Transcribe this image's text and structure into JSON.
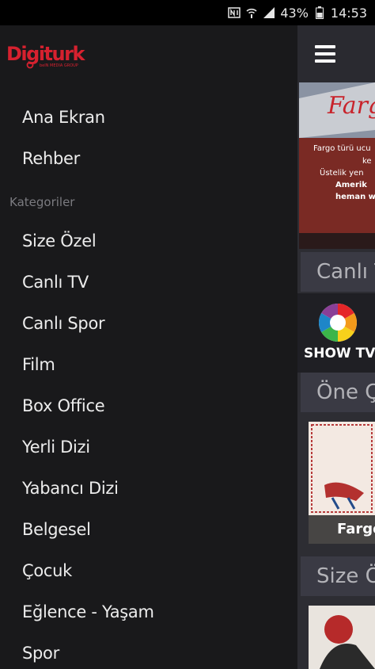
{
  "status_bar": {
    "battery": "43%",
    "time": "14:53",
    "icons": [
      "nfc-icon",
      "wifi-icon",
      "signal-icon",
      "battery-icon"
    ]
  },
  "brand": {
    "name": "Digiturk",
    "tagline": "beIN MEDIA GROUP",
    "accent": "#d6212f"
  },
  "drawer": {
    "top_items": [
      {
        "label": "Ana Ekran"
      },
      {
        "label": "Rehber"
      }
    ],
    "section_label": "Kategoriler",
    "category_items": [
      {
        "label": "Size Özel"
      },
      {
        "label": "Canlı TV"
      },
      {
        "label": "Canlı Spor"
      },
      {
        "label": "Film"
      },
      {
        "label": "Box Office"
      },
      {
        "label": "Yerli Dizi"
      },
      {
        "label": "Yabancı Dizi"
      },
      {
        "label": "Belgesel"
      },
      {
        "label": "Çocuk"
      },
      {
        "label": "Eğlence - Yaşam"
      },
      {
        "label": "Spor"
      }
    ]
  },
  "content": {
    "banner": {
      "title": "Fargo",
      "lines": [
        "Fargo türü ucu",
        "ke",
        "Üstelik yen",
        "Amerik",
        "heman w"
      ]
    },
    "section_live": "Canlı T",
    "channel_name": "SHOW TV",
    "section_featured": "Öne Çık",
    "card_title": "Fargo",
    "section_foryou": "Size Öz"
  }
}
